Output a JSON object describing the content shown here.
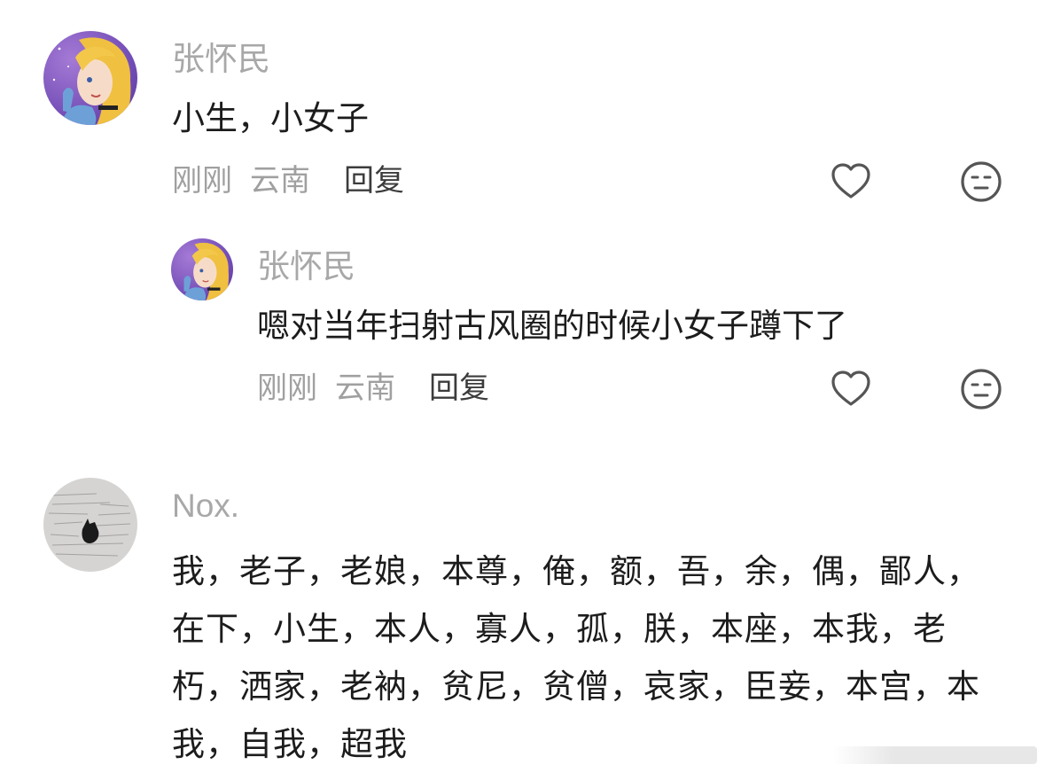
{
  "comments": [
    {
      "username": "张怀民",
      "text": "小生，小女子",
      "time": "刚刚",
      "location": "云南",
      "reply_label": "回复",
      "like_icon": "heart-outline-icon",
      "dislike_icon": "meh-face-icon",
      "replies": [
        {
          "username": "张怀民",
          "text": "嗯对当年扫射古风圈的时候小女子蹲下了",
          "time": "刚刚",
          "location": "云南",
          "reply_label": "回复",
          "like_icon": "heart-outline-icon",
          "dislike_icon": "meh-face-icon"
        }
      ]
    },
    {
      "username": "Nox.",
      "text": "我，老子，老娘，本尊，俺，额，吾，余，偶，鄙人，在下，小生，本人，寡人，孤，朕，本座，本我，老朽，洒家，老衲，贫尼，贫僧，哀家，臣妾，本宫，本我，自我，超我"
    }
  ],
  "colors": {
    "username": "#a8a8a8",
    "text": "#1c1c1c",
    "meta": "#a0a0a0",
    "reply": "#3c3c3c",
    "icon": "#555555"
  }
}
